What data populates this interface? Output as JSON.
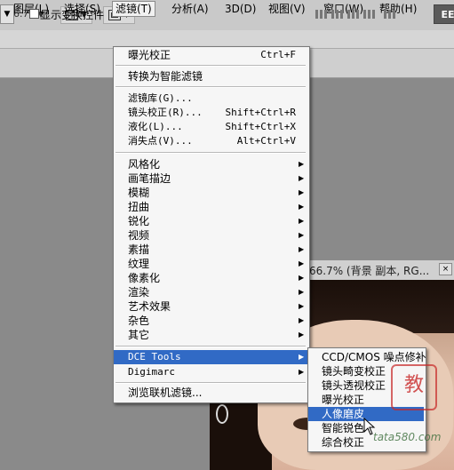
{
  "toolbar": {
    "zoom": "66.7",
    "essentials_label": "EE"
  },
  "menubar": {
    "items": [
      "图层(L)",
      "选择(S)",
      "滤镜(T)",
      "分析(A)",
      "3D(D)",
      "视图(V)",
      "窗口(W)",
      "帮助(H)"
    ],
    "active": "滤镜(T)"
  },
  "options": {
    "show_transform_controls": "显示变换控件",
    "checked": false
  },
  "document": {
    "title": "66.7% (背景 副本, RG...",
    "close": "×"
  },
  "filter_menu": {
    "last_filter": {
      "label": "曝光校正",
      "shortcut": "Ctrl+F"
    },
    "convert_smart": "转换为智能滤镜",
    "group2": [
      {
        "label": "滤镜库(G)...",
        "shortcut": ""
      },
      {
        "label": "镜头校正(R)...",
        "shortcut": "Shift+Ctrl+R"
      },
      {
        "label": "液化(L)...",
        "shortcut": "Shift+Ctrl+X"
      },
      {
        "label": "消失点(V)...",
        "shortcut": "Alt+Ctrl+V"
      }
    ],
    "submenus": [
      "风格化",
      "画笔描边",
      "模糊",
      "扭曲",
      "锐化",
      "视频",
      "素描",
      "纹理",
      "像素化",
      "渲染",
      "艺术效果",
      "杂色",
      "其它"
    ],
    "plugins": [
      "DCE Tools",
      "Digimarc"
    ],
    "browse_online": "浏览联机滤镜..."
  },
  "dce_submenu": {
    "items": [
      "CCD/CMOS 噪点修补",
      "镜头畸变校正",
      "镜头透视校正",
      "曝光校正",
      "人像磨皮",
      "智能锐色",
      "综合校正"
    ],
    "highlighted": "人像磨皮"
  },
  "watermark": {
    "stamp": "教",
    "text": "tata580.com"
  }
}
